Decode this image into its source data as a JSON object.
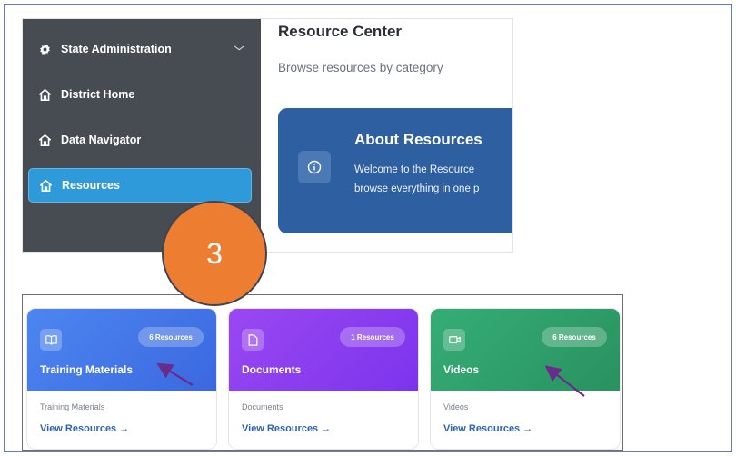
{
  "sidebar": {
    "items": [
      {
        "label": "State Administration",
        "icon": "gear-icon"
      },
      {
        "label": "District Home",
        "icon": "home-icon"
      },
      {
        "label": "Data Navigator",
        "icon": "home-icon"
      },
      {
        "label": "Resources",
        "icon": "home-icon",
        "active": true
      }
    ]
  },
  "main": {
    "title": "Resource Center",
    "subtitle": "Browse resources by category",
    "about": {
      "title": "About Resources",
      "line1": "Welcome to the Resource",
      "line2": "browse everything in one p"
    }
  },
  "step": {
    "number": "3",
    "color": "#ed7d31"
  },
  "categories": [
    {
      "name": "Training Materials",
      "count": "6 Resources",
      "description": "Training Materials",
      "link": "View Resources →",
      "color": "#3f74ea",
      "icon": "book-open-icon"
    },
    {
      "name": "Documents",
      "count": "1 Resources",
      "description": "Documents",
      "link": "View Resources →",
      "color": "#8a3ff0",
      "icon": "document-icon"
    },
    {
      "name": "Videos",
      "count": "6 Resources",
      "description": "Videos",
      "link": "View Resources →",
      "color": "#2f9e6a",
      "icon": "video-icon"
    }
  ],
  "annotation_color": "#6a2c8c"
}
